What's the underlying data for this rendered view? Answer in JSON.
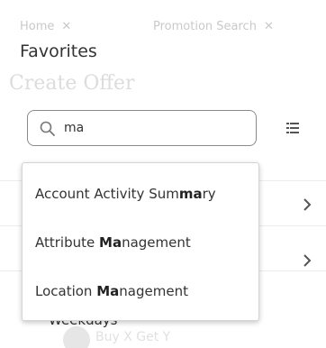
{
  "background": {
    "tabs": [
      {
        "label": "Home",
        "close": "✕"
      },
      {
        "label": "Promotion Search",
        "close": "✕"
      }
    ],
    "page_title": "Create Offer",
    "faint_snippets": [
      "Buy X Get Y"
    ]
  },
  "favorites": {
    "title": "Favorites",
    "search": {
      "value": "ma",
      "placeholder": ""
    },
    "suggestions": [
      {
        "pre": "Account Activity Sum",
        "bold": "ma",
        "post": "ry"
      },
      {
        "pre": "Attribute ",
        "bold": "Ma",
        "post": "nagement"
      },
      {
        "pre": "Location ",
        "bold": "Ma",
        "post": "nagement"
      }
    ],
    "below_text": "Weekdays"
  },
  "icons": {
    "search": "search-icon",
    "list": "list-icon",
    "chevron": "chevron-right-icon"
  },
  "colors": {
    "text": "#333333",
    "border": "#8a8a8a",
    "faded": "#c9c9c9"
  }
}
